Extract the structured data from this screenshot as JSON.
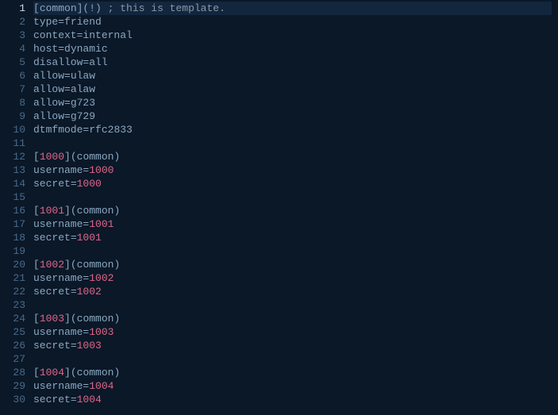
{
  "highlighted_line_index": 0,
  "lines": [
    {
      "no": 1,
      "tokens": [
        {
          "c": "t-punc",
          "t": "["
        },
        {
          "c": "t-ident",
          "t": "common"
        },
        {
          "c": "t-punc",
          "t": "]("
        },
        {
          "c": "t-punc",
          "t": "!"
        },
        {
          "c": "t-punc",
          "t": ") "
        },
        {
          "c": "t-comment",
          "t": "; this is template."
        }
      ]
    },
    {
      "no": 2,
      "tokens": [
        {
          "c": "t-ident",
          "t": "type"
        },
        {
          "c": "t-eq",
          "t": "="
        },
        {
          "c": "t-plain",
          "t": "friend"
        }
      ]
    },
    {
      "no": 3,
      "tokens": [
        {
          "c": "t-ident",
          "t": "context"
        },
        {
          "c": "t-eq",
          "t": "="
        },
        {
          "c": "t-plain",
          "t": "internal"
        }
      ]
    },
    {
      "no": 4,
      "tokens": [
        {
          "c": "t-ident",
          "t": "host"
        },
        {
          "c": "t-eq",
          "t": "="
        },
        {
          "c": "t-plain",
          "t": "dynamic"
        }
      ]
    },
    {
      "no": 5,
      "tokens": [
        {
          "c": "t-ident",
          "t": "disallow"
        },
        {
          "c": "t-eq",
          "t": "="
        },
        {
          "c": "t-plain",
          "t": "all"
        }
      ]
    },
    {
      "no": 6,
      "tokens": [
        {
          "c": "t-ident",
          "t": "allow"
        },
        {
          "c": "t-eq",
          "t": "="
        },
        {
          "c": "t-plain",
          "t": "ulaw"
        }
      ]
    },
    {
      "no": 7,
      "tokens": [
        {
          "c": "t-ident",
          "t": "allow"
        },
        {
          "c": "t-eq",
          "t": "="
        },
        {
          "c": "t-plain",
          "t": "alaw"
        }
      ]
    },
    {
      "no": 8,
      "tokens": [
        {
          "c": "t-ident",
          "t": "allow"
        },
        {
          "c": "t-eq",
          "t": "="
        },
        {
          "c": "t-plain",
          "t": "g723"
        }
      ]
    },
    {
      "no": 9,
      "tokens": [
        {
          "c": "t-ident",
          "t": "allow"
        },
        {
          "c": "t-eq",
          "t": "="
        },
        {
          "c": "t-plain",
          "t": "g729"
        }
      ]
    },
    {
      "no": 10,
      "tokens": [
        {
          "c": "t-ident",
          "t": "dtmfmode"
        },
        {
          "c": "t-eq",
          "t": "="
        },
        {
          "c": "t-plain",
          "t": "rfc2833"
        }
      ]
    },
    {
      "no": 11,
      "tokens": []
    },
    {
      "no": 12,
      "tokens": [
        {
          "c": "t-punc",
          "t": "["
        },
        {
          "c": "t-num",
          "t": "1000"
        },
        {
          "c": "t-punc",
          "t": "]("
        },
        {
          "c": "t-ident",
          "t": "common"
        },
        {
          "c": "t-punc",
          "t": ")"
        }
      ]
    },
    {
      "no": 13,
      "tokens": [
        {
          "c": "t-ident",
          "t": "username"
        },
        {
          "c": "t-eq",
          "t": "="
        },
        {
          "c": "t-num",
          "t": "1000"
        }
      ]
    },
    {
      "no": 14,
      "tokens": [
        {
          "c": "t-ident",
          "t": "secret"
        },
        {
          "c": "t-eq",
          "t": "="
        },
        {
          "c": "t-num",
          "t": "1000"
        }
      ]
    },
    {
      "no": 15,
      "tokens": []
    },
    {
      "no": 16,
      "tokens": [
        {
          "c": "t-punc",
          "t": "["
        },
        {
          "c": "t-num",
          "t": "1001"
        },
        {
          "c": "t-punc",
          "t": "]("
        },
        {
          "c": "t-ident",
          "t": "common"
        },
        {
          "c": "t-punc",
          "t": ")"
        }
      ]
    },
    {
      "no": 17,
      "tokens": [
        {
          "c": "t-ident",
          "t": "username"
        },
        {
          "c": "t-eq",
          "t": "="
        },
        {
          "c": "t-num",
          "t": "1001"
        }
      ]
    },
    {
      "no": 18,
      "tokens": [
        {
          "c": "t-ident",
          "t": "secret"
        },
        {
          "c": "t-eq",
          "t": "="
        },
        {
          "c": "t-num",
          "t": "1001"
        }
      ]
    },
    {
      "no": 19,
      "tokens": []
    },
    {
      "no": 20,
      "tokens": [
        {
          "c": "t-punc",
          "t": "["
        },
        {
          "c": "t-num",
          "t": "1002"
        },
        {
          "c": "t-punc",
          "t": "]("
        },
        {
          "c": "t-ident",
          "t": "common"
        },
        {
          "c": "t-punc",
          "t": ")"
        }
      ]
    },
    {
      "no": 21,
      "tokens": [
        {
          "c": "t-ident",
          "t": "username"
        },
        {
          "c": "t-eq",
          "t": "="
        },
        {
          "c": "t-num",
          "t": "1002"
        }
      ]
    },
    {
      "no": 22,
      "tokens": [
        {
          "c": "t-ident",
          "t": "secret"
        },
        {
          "c": "t-eq",
          "t": "="
        },
        {
          "c": "t-num",
          "t": "1002"
        }
      ]
    },
    {
      "no": 23,
      "tokens": []
    },
    {
      "no": 24,
      "tokens": [
        {
          "c": "t-punc",
          "t": "["
        },
        {
          "c": "t-num",
          "t": "1003"
        },
        {
          "c": "t-punc",
          "t": "]("
        },
        {
          "c": "t-ident",
          "t": "common"
        },
        {
          "c": "t-punc",
          "t": ")"
        }
      ]
    },
    {
      "no": 25,
      "tokens": [
        {
          "c": "t-ident",
          "t": "username"
        },
        {
          "c": "t-eq",
          "t": "="
        },
        {
          "c": "t-num",
          "t": "1003"
        }
      ]
    },
    {
      "no": 26,
      "tokens": [
        {
          "c": "t-ident",
          "t": "secret"
        },
        {
          "c": "t-eq",
          "t": "="
        },
        {
          "c": "t-num",
          "t": "1003"
        }
      ]
    },
    {
      "no": 27,
      "tokens": []
    },
    {
      "no": 28,
      "tokens": [
        {
          "c": "t-punc",
          "t": "["
        },
        {
          "c": "t-num",
          "t": "1004"
        },
        {
          "c": "t-punc",
          "t": "]("
        },
        {
          "c": "t-ident",
          "t": "common"
        },
        {
          "c": "t-punc",
          "t": ")"
        }
      ]
    },
    {
      "no": 29,
      "tokens": [
        {
          "c": "t-ident",
          "t": "username"
        },
        {
          "c": "t-eq",
          "t": "="
        },
        {
          "c": "t-num",
          "t": "1004"
        }
      ]
    },
    {
      "no": 30,
      "tokens": [
        {
          "c": "t-ident",
          "t": "secret"
        },
        {
          "c": "t-eq",
          "t": "="
        },
        {
          "c": "t-num",
          "t": "1004"
        }
      ]
    }
  ]
}
